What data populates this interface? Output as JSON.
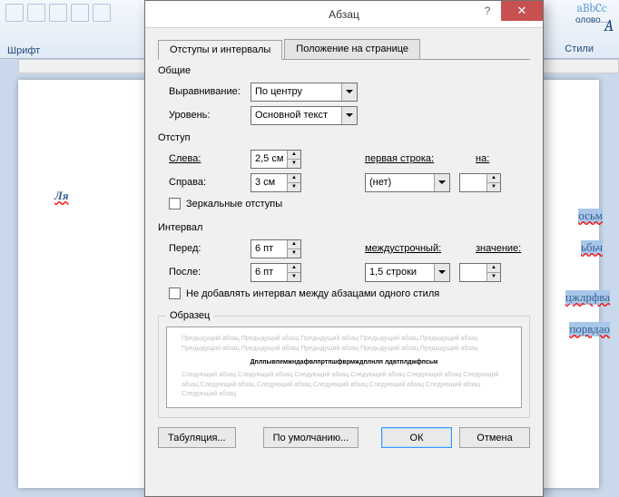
{
  "window": {
    "title": "Абзац",
    "help": "?",
    "close": "✕"
  },
  "tabs": {
    "indents": "Отступы и интервалы",
    "position": "Положение на странице"
  },
  "general": {
    "title": "Общие",
    "align_label": "Выравнивание:",
    "align_value": "По центру",
    "level_label": "Уровень:",
    "level_value": "Основной текст"
  },
  "indent": {
    "title": "Отступ",
    "left_label": "Слева:",
    "left_value": "2,5 см",
    "right_label": "Справа:",
    "right_value": "3 см",
    "firstline_label": "первая строка:",
    "firstline_value": "(нет)",
    "by_label": "на:",
    "by_value": "",
    "mirror_label": "Зеркальные отступы"
  },
  "spacing": {
    "title": "Интервал",
    "before_label": "Перед:",
    "before_value": "6 пт",
    "after_label": "После:",
    "after_value": "6 пт",
    "line_label": "междустрочный:",
    "line_value": "1,5 строки",
    "value_label": "значение:",
    "value_value": "",
    "nospace_label": "Не добавлять интервал между абзацами одного стиля"
  },
  "preview": {
    "title": "Образец",
    "before_text": "Предыдущий абзац Предыдущий абзац Предыдущий абзац Предыдущий абзац Предыдущий абзац Предыдущий абзац Предыдущий абзац Предыдущий абзац Предыдущий абзац Предыдущий абзац",
    "sample_text": "Дплпывпемжндафвлпртпшфврмждплнлп лдвтплджфпсьм",
    "after_text": "Следующий абзац Следующий абзац Следующий абзац Следующий абзац Следующий абзац Следующий абзац Следующий абзац Следующий абзац Следующий абзац Следующий абзац Следующий абзац Следующий абзац"
  },
  "buttons": {
    "tabs": "Табуляция...",
    "default": "По умолчанию...",
    "ok": "ОК",
    "cancel": "Отмена"
  },
  "ribbon": {
    "font_label": "Шрифт",
    "styles_label": "Стили",
    "style_preview": "aBbCc",
    "style_name": "олово..."
  },
  "bg_words": {
    "w1": "Ля",
    "w2": "осьм",
    "w3": "ьбьч",
    "w4": "цжлрфва",
    "w5": "порвдао"
  }
}
